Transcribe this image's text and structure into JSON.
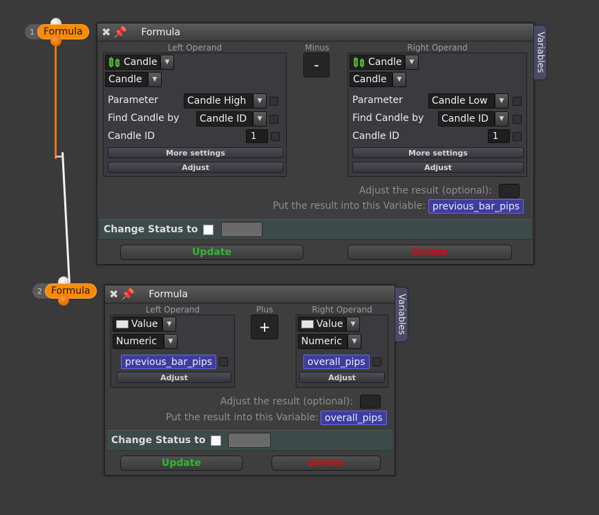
{
  "nodes": [
    {
      "number": "1",
      "label": "Formula"
    },
    {
      "number": "2",
      "label": "Formula"
    }
  ],
  "colors": {
    "node_accent": "#ff8a00",
    "variable_chip": "#3f3d9e",
    "update_text": "#2fb82f",
    "delete_text": "#cc1111",
    "status_band": "#3c4b49"
  },
  "panel1": {
    "title": "Formula",
    "variables_tab": "Variables",
    "operator_caption": "Minus",
    "operator_symbol": "-",
    "left": {
      "caption": "Left Operand",
      "type": "Candle",
      "subtype": "Candle",
      "parameter_label": "Parameter",
      "parameter_value": "Candle High",
      "find_label": "Find Candle by",
      "find_value": "Candle ID",
      "id_label": "Candle ID",
      "id_value": "1",
      "more_settings": "More settings",
      "adjust": "Adjust"
    },
    "right": {
      "caption": "Right Operand",
      "type": "Candle",
      "subtype": "Candle",
      "parameter_label": "Parameter",
      "parameter_value": "Candle Low",
      "find_label": "Find Candle by",
      "find_value": "Candle ID",
      "id_label": "Candle ID",
      "id_value": "1",
      "more_settings": "More settings",
      "adjust": "Adjust"
    },
    "adjust_result_label": "Adjust the result (optional):",
    "put_result_label": "Put the result into this Variable:",
    "result_variable": "previous_bar_pips",
    "change_status_label": "Change Status to",
    "update_label": "Update",
    "delete_label": "Delete"
  },
  "panel2": {
    "title": "Formula",
    "variables_tab": "Variables",
    "operator_caption": "Plus",
    "operator_symbol": "+",
    "left": {
      "caption": "Left Operand",
      "type": "Value",
      "subtype": "Numeric",
      "variable": "previous_bar_pips",
      "adjust": "Adjust"
    },
    "right": {
      "caption": "Right Operand",
      "type": "Value",
      "subtype": "Numeric",
      "variable": "overall_pips",
      "adjust": "Adjust"
    },
    "adjust_result_label": "Adjust the result (optional):",
    "put_result_label": "Put the result into this Variable:",
    "result_variable": "overall_pips",
    "change_status_label": "Change Status to",
    "update_label": "Update",
    "delete_label": "Delete"
  }
}
